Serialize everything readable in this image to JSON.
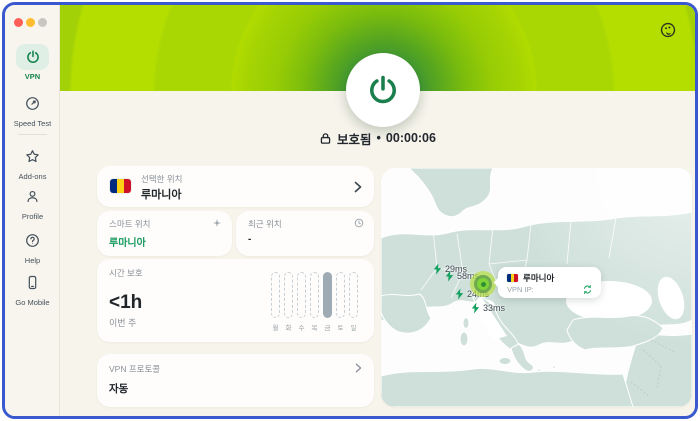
{
  "window": {
    "traffic_lights": [
      "close",
      "minimize",
      "zoom"
    ]
  },
  "sidebar": {
    "items": [
      {
        "id": "vpn",
        "label": "VPN",
        "active": true
      },
      {
        "id": "speed-test",
        "label": "Speed Test",
        "active": false
      },
      {
        "id": "add-ons",
        "label": "Add-ons",
        "active": false
      },
      {
        "id": "profile",
        "label": "Profile",
        "active": false
      },
      {
        "id": "help",
        "label": "Help",
        "active": false
      },
      {
        "id": "go-mobile",
        "label": "Go Mobile",
        "active": false
      }
    ]
  },
  "header": {
    "theme_icon": "palette-icon"
  },
  "status": {
    "label": "보호됨",
    "separator": "•",
    "timer": "00:00:06"
  },
  "cards": {
    "selected_location": {
      "label": "선택한 위치",
      "value": "루마니아",
      "flag": "romania"
    },
    "smart_location": {
      "label": "스마트 위치",
      "value": "루마니아",
      "icon": "sparkle-icon"
    },
    "recent_location": {
      "label": "최근 위치",
      "value": "-",
      "icon": "clock-icon"
    },
    "time_protected": {
      "label": "시간 보호",
      "value": "<1h",
      "subtitle": "이번 주",
      "days": [
        "월",
        "화",
        "수",
        "목",
        "금",
        "토",
        "일"
      ],
      "active_day_index": 4
    },
    "vpn_protocol": {
      "label": "VPN 프로토콜",
      "value": "자동"
    }
  },
  "map": {
    "pings": [
      {
        "label": "29ms"
      },
      {
        "label": "58ms"
      },
      {
        "label": "24ms"
      },
      {
        "label": "33ms"
      }
    ],
    "tooltip": {
      "country": "루마니아",
      "ip_label": "VPN IP:",
      "flag": "romania"
    }
  },
  "appearance": {
    "accent_green": "#1d9e63",
    "header_lime": "#b2dc00",
    "header_dark_green": "#2e8f4a",
    "active_item_bg": "#e0efe5",
    "focus_ring_blue": "#3a59cf",
    "bar_fill": "#9fabb4",
    "map_land": "#cfe0da",
    "flag_colors": [
      "#002B7F",
      "#FCD116",
      "#CE1126"
    ],
    "traffic_lights": [
      "#ff5f57",
      "#febc2e",
      "#c9c6c2"
    ]
  }
}
